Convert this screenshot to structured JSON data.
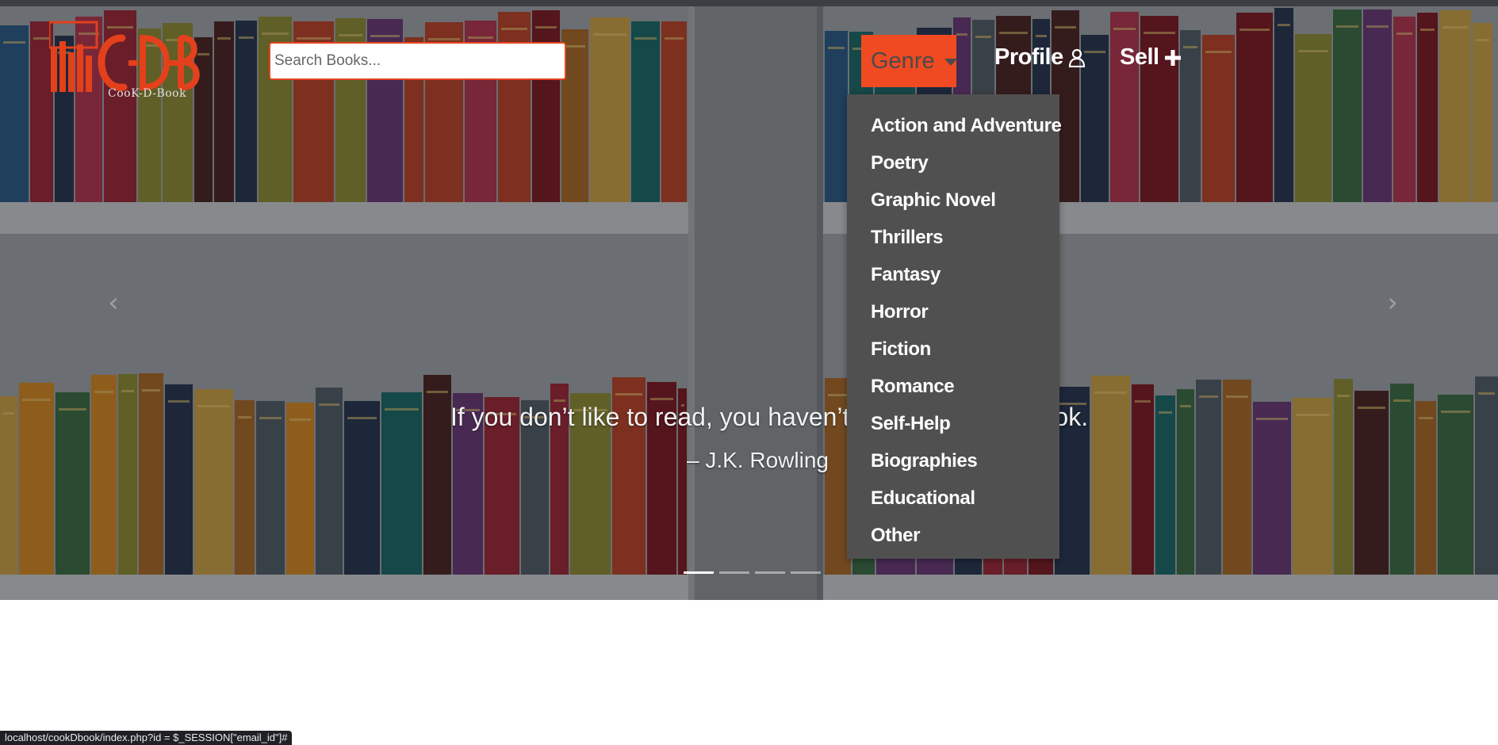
{
  "logo": {
    "alt_text": "C-D-B",
    "subtitle": "CooK-D-Book"
  },
  "search": {
    "placeholder": "Search Books..."
  },
  "nav": {
    "genre_label": "Genre",
    "profile_label": "Profile",
    "sell_label": "Sell"
  },
  "genre_menu": {
    "items": [
      "Action and Adventure",
      "Poetry",
      "Graphic Novel",
      "Thrillers",
      "Fantasy",
      "Horror",
      "Fiction",
      "Romance",
      "Self-Help",
      "Biographies",
      "Educational",
      "Other"
    ]
  },
  "carousel": {
    "quote": "If you don’t like to read, you haven’t found the right book.",
    "author": "– J.K. Rowling",
    "prev_icon": "chevron-left-icon",
    "next_icon": "chevron-right-icon",
    "slide_count": 4,
    "active_slide": 1
  },
  "status_bar": {
    "url": "localhost/cookDbook/index.php?id = $_SESSION[\"email_id\"]#"
  },
  "colors": {
    "accent": "#f04a22",
    "dropdown_bg": "#505050",
    "nav_text": "#ffffff"
  }
}
